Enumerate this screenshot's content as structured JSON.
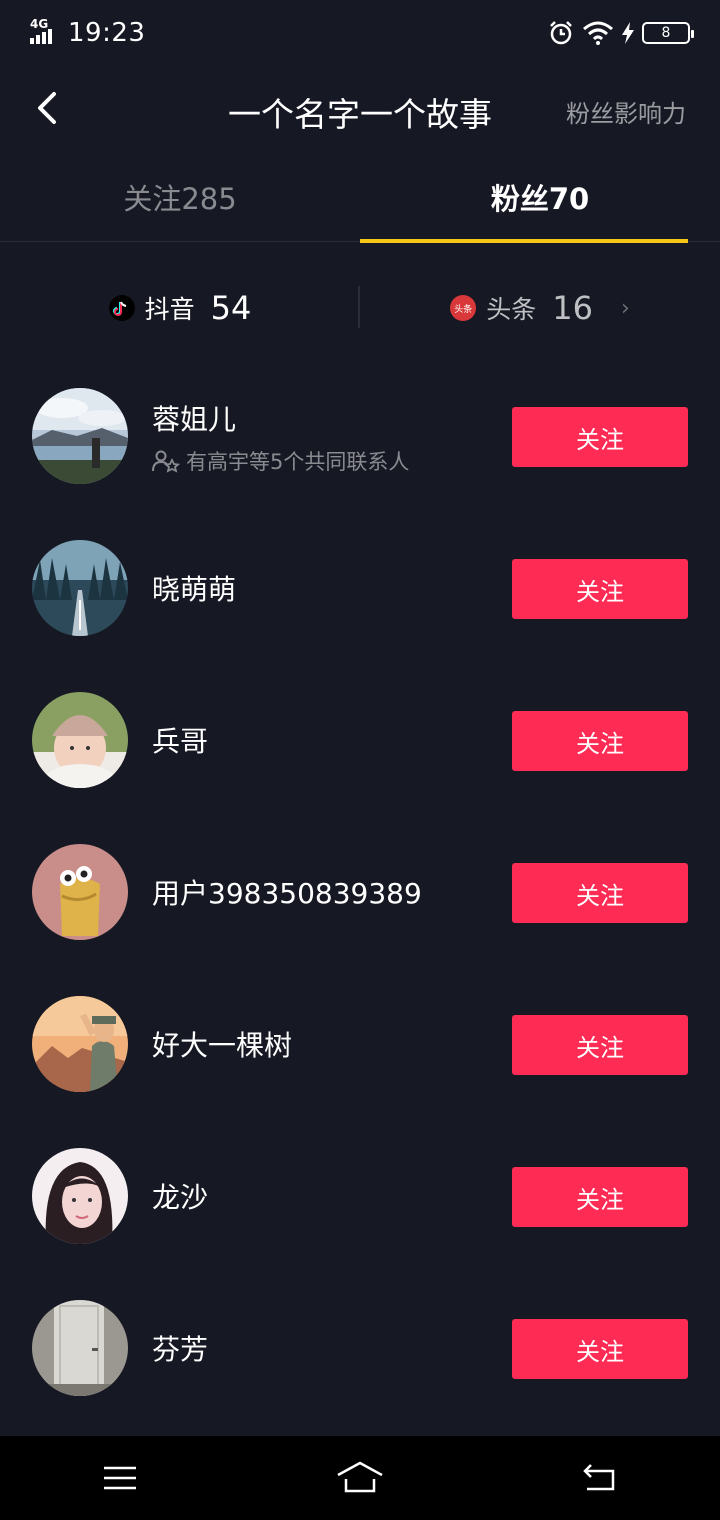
{
  "status_bar": {
    "network": "4G",
    "time": "19:23",
    "battery": "8"
  },
  "header": {
    "title": "一个名字一个故事",
    "right_link": "粉丝影响力"
  },
  "tabs": [
    {
      "label": "关注285",
      "active": false
    },
    {
      "label": "粉丝70",
      "active": true
    }
  ],
  "sources": {
    "douyin": {
      "label": "抖音",
      "count": "54",
      "icon": "douyin-icon"
    },
    "toutiao": {
      "label": "头条",
      "count": "16",
      "icon": "toutiao-icon",
      "badge": "头条"
    }
  },
  "followers": [
    {
      "name": "蓉姐儿",
      "sub": "有高宇等5个共同联系人",
      "button": "关注"
    },
    {
      "name": "晓萌萌",
      "button": "关注"
    },
    {
      "name": "兵哥",
      "button": "关注"
    },
    {
      "name": "用户398350839389",
      "button": "关注"
    },
    {
      "name": "好大一棵树",
      "button": "关注"
    },
    {
      "name": "龙沙",
      "button": "关注"
    },
    {
      "name": "芬芳",
      "button": "关注"
    }
  ],
  "colors": {
    "background": "#161823",
    "follow_button": "#fe2c55",
    "tab_indicator": "#f5c518"
  }
}
